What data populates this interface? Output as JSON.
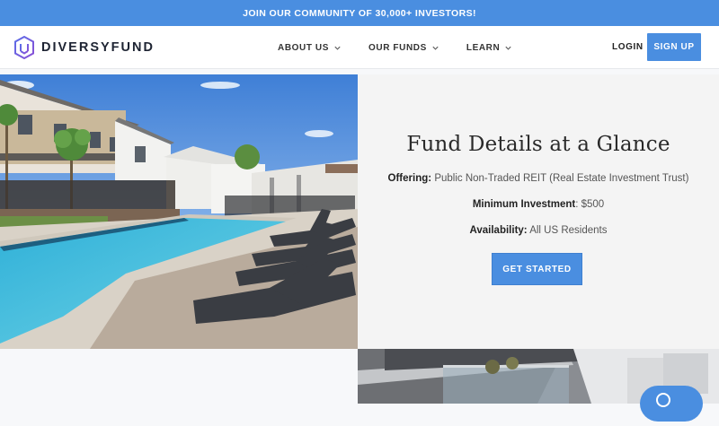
{
  "banner": {
    "text": "JOIN OUR COMMUNITY OF 30,000+ INVESTORS!"
  },
  "brand": {
    "name": "DIVERSYFUND",
    "accent": "#4a8ee0"
  },
  "nav": {
    "items": [
      {
        "label": "ABOUT US",
        "icon": "chevron-down-icon"
      },
      {
        "label": "OUR FUNDS",
        "icon": "chevron-down-icon"
      },
      {
        "label": "LEARN",
        "icon": "chevron-down-icon"
      }
    ],
    "login_label": "LOGIN",
    "signup_label": "SIGN UP"
  },
  "fund": {
    "title": "Fund Details at a Glance",
    "rows": [
      {
        "label": "Offering",
        "value": "Public Non-Traded REIT (Real Estate Investment Trust)"
      },
      {
        "label": "Minimum Investment",
        "value": "$500"
      },
      {
        "label": "Availability",
        "value": "All US Residents"
      }
    ],
    "cta_label": "GET STARTED"
  },
  "chat": {
    "icon": "chat-icon"
  }
}
